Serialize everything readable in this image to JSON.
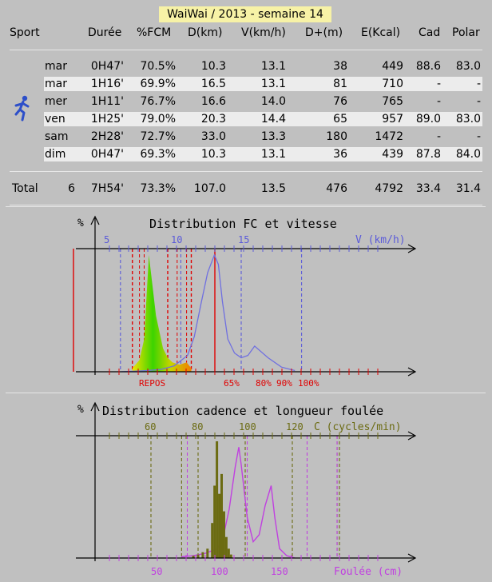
{
  "title": "WaiWai / 2013 - semaine 14",
  "headers": {
    "sport": "Sport",
    "duree": "Durée",
    "fcm": "%FCM",
    "dist": "D(km)",
    "speed": "V(km/h)",
    "dplus": "D+(m)",
    "energy": "E(Kcal)",
    "cad": "Cad",
    "polar": "Polar"
  },
  "rows": [
    {
      "day": "mar",
      "duree": "0H47'",
      "fcm": "70.5%",
      "dist": "10.3",
      "speed": "13.1",
      "dplus": "38",
      "energy": "449",
      "cad": "88.6",
      "polar": "83.0"
    },
    {
      "day": "mar",
      "duree": "1H16'",
      "fcm": "69.9%",
      "dist": "16.5",
      "speed": "13.1",
      "dplus": "81",
      "energy": "710",
      "cad": "-",
      "polar": "-"
    },
    {
      "day": "mer",
      "duree": "1H11'",
      "fcm": "76.7%",
      "dist": "16.6",
      "speed": "14.0",
      "dplus": "76",
      "energy": "765",
      "cad": "-",
      "polar": "-"
    },
    {
      "day": "ven",
      "duree": "1H25'",
      "fcm": "79.0%",
      "dist": "20.3",
      "speed": "14.4",
      "dplus": "65",
      "energy": "957",
      "cad": "89.0",
      "polar": "83.0"
    },
    {
      "day": "sam",
      "duree": "2H28'",
      "fcm": "72.7%",
      "dist": "33.0",
      "speed": "13.3",
      "dplus": "180",
      "energy": "1472",
      "cad": "-",
      "polar": "-"
    },
    {
      "day": "dim",
      "duree": "0H47'",
      "fcm": "69.3%",
      "dist": "10.3",
      "speed": "13.1",
      "dplus": "36",
      "energy": "439",
      "cad": "87.8",
      "polar": "84.0"
    }
  ],
  "total": {
    "label": "Total",
    "count": "6",
    "duree": "7H54'",
    "fcm": "73.3%",
    "dist": "107.0",
    "speed": "13.5",
    "dplus": "476",
    "energy": "4792",
    "cad": "33.4",
    "polar": "31.4"
  },
  "sport_icon": "runner-icon",
  "colors": {
    "title_bg": "#f7f2a6",
    "row_highlight": "#ececec",
    "axis_blue": "#5b5bd9",
    "hr_red": "#e00000",
    "speed_line": "#6f6fe0",
    "cadence": "#6b6b12",
    "stride": "#c040e0"
  },
  "chart_data": [
    {
      "type": "area",
      "title": "Distribution FC et vitesse",
      "y_axis_label": "%",
      "x_axis_label": "V (km/h)",
      "x_ticks": [
        "5",
        "10",
        "15"
      ],
      "zones": [
        "REPOS",
        "65%",
        "80%",
        "90%",
        "100%"
      ],
      "speed_distribution": {
        "x": [
          6,
          7,
          8,
          9,
          10,
          11,
          11.5,
          12,
          12.5,
          13,
          13.3,
          13.6,
          14,
          14.5,
          15,
          15.5,
          16,
          17,
          18,
          19
        ],
        "y": [
          0,
          0.5,
          1,
          2,
          5,
          14,
          30,
          58,
          85,
          100,
          92,
          60,
          28,
          16,
          12,
          14,
          22,
          12,
          4,
          1
        ]
      },
      "hr_distribution": {
        "zone_pct": [
          65,
          68,
          70,
          72,
          75,
          78,
          80,
          82,
          85,
          88,
          90
        ],
        "y": [
          3,
          10,
          28,
          100,
          48,
          20,
          12,
          8,
          6,
          8,
          3
        ]
      }
    },
    {
      "type": "bar",
      "title": "Distribution cadence et longueur foulée",
      "y_axis_label": "%",
      "x_axis_label": "C (cycles/min)",
      "x_ticks": [
        "60",
        "80",
        "100",
        "120"
      ],
      "x2_axis_label": "Foulée (cm)",
      "x2_ticks": [
        "50",
        "100",
        "150"
      ],
      "cadence_distribution": {
        "x": [
          78,
          80,
          82,
          84,
          86,
          87,
          88,
          89,
          90,
          91,
          92,
          93,
          94
        ],
        "y": [
          2,
          3,
          5,
          8,
          30,
          62,
          100,
          55,
          72,
          40,
          18,
          8,
          3
        ]
      },
      "stride_distribution": {
        "x": [
          70,
          80,
          90,
          100,
          105,
          110,
          115,
          118,
          120,
          125,
          130,
          135,
          140,
          145,
          148,
          152,
          158,
          165
        ],
        "y": [
          1,
          2,
          4,
          8,
          18,
          42,
          78,
          95,
          80,
          35,
          14,
          20,
          45,
          62,
          35,
          8,
          2,
          0
        ]
      }
    }
  ]
}
